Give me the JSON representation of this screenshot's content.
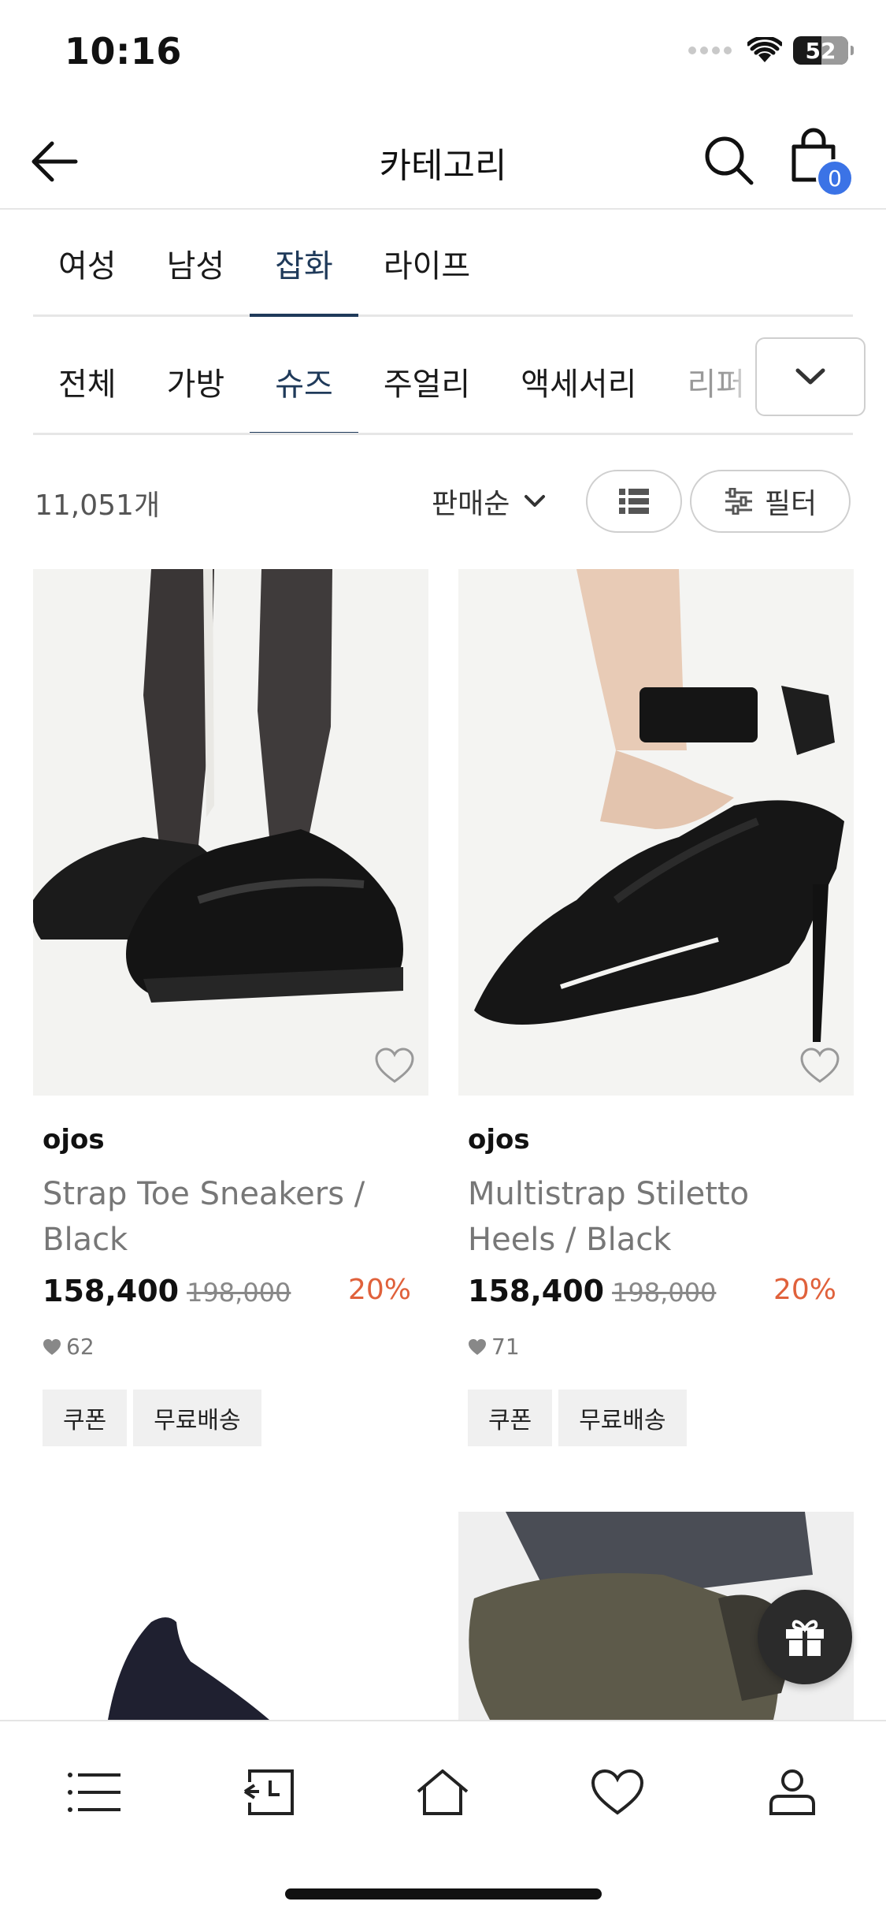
{
  "status_bar": {
    "time": "10:16",
    "battery": "52"
  },
  "header": {
    "title": "카테고리",
    "cart_count": "0"
  },
  "primary_tabs": [
    {
      "label": "여성",
      "active": false
    },
    {
      "label": "남성",
      "active": false
    },
    {
      "label": "잡화",
      "active": true
    },
    {
      "label": "라이프",
      "active": false
    }
  ],
  "secondary_tabs": [
    {
      "label": "전체",
      "active": false
    },
    {
      "label": "가방",
      "active": false
    },
    {
      "label": "슈즈",
      "active": true
    },
    {
      "label": "주얼리",
      "active": false
    },
    {
      "label": "액세서리",
      "active": false
    },
    {
      "label": "리퍼",
      "active": false
    }
  ],
  "toolbar": {
    "count": "11,051개",
    "sort": "판매순",
    "filter_label": "필터"
  },
  "products": [
    {
      "brand": "ojos",
      "name": "Strap Toe Sneakers / Black",
      "price": "158,400",
      "original_price": "198,000",
      "discount": "20%",
      "likes": "62",
      "tags": [
        "쿠폰",
        "무료배송"
      ]
    },
    {
      "brand": "ojos",
      "name": "Multistrap Stiletto Heels / Black",
      "price": "158,400",
      "original_price": "198,000",
      "discount": "20%",
      "likes": "71",
      "tags": [
        "쿠폰",
        "무료배송"
      ]
    }
  ],
  "icons": {
    "back": "arrow-left-icon",
    "search": "search-icon",
    "cart": "shopping-bag-icon",
    "expand": "chevron-down-icon",
    "list_view": "list-view-icon",
    "filter": "sliders-icon",
    "wishlist": "heart-outline-icon",
    "gift": "gift-icon",
    "nav": [
      "menu-icon",
      "recent-icon",
      "home-icon",
      "heart-icon",
      "user-icon"
    ]
  },
  "colors": {
    "accent": "#1f3a5a",
    "badge": "#3b73e6",
    "discount": "#e0613b"
  }
}
